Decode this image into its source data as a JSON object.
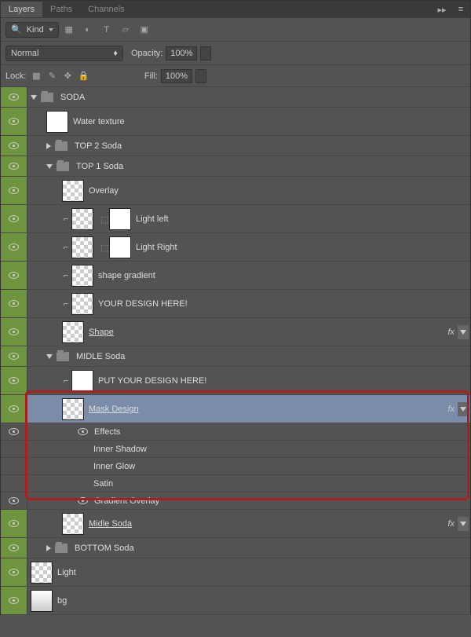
{
  "tabs": {
    "layers": "Layers",
    "paths": "Paths",
    "channels": "Channels"
  },
  "toolbar": {
    "kind_label": "Kind",
    "blend_mode": "Normal",
    "opacity_label": "Opacity:",
    "opacity_value": "100%",
    "lock_label": "Lock:",
    "fill_label": "Fill:",
    "fill_value": "100%"
  },
  "layers": [
    {
      "name": "SODA",
      "type": "group",
      "open": true,
      "indent": 0
    },
    {
      "name": "Water texture",
      "type": "layer",
      "thumb": "white",
      "indent": 1
    },
    {
      "name": "TOP 2 Soda",
      "type": "group",
      "open": false,
      "indent": 1
    },
    {
      "name": "TOP 1 Soda",
      "type": "group",
      "open": true,
      "indent": 1
    },
    {
      "name": "Overlay",
      "type": "layer",
      "thumb": "checker",
      "indent": 2
    },
    {
      "name": "Light left",
      "type": "layer",
      "thumb": "checker",
      "mask": true,
      "clip": true,
      "indent": 2
    },
    {
      "name": "Light Right",
      "type": "layer",
      "thumb": "checker",
      "mask": true,
      "clip": true,
      "indent": 2
    },
    {
      "name": "shape gradient",
      "type": "layer",
      "thumb": "checker",
      "clip": true,
      "indent": 2
    },
    {
      "name": "YOUR DESIGN HERE!",
      "type": "layer",
      "thumb": "checker",
      "clip": true,
      "indent": 2
    },
    {
      "name": "Shape ",
      "type": "layer",
      "thumb": "checker",
      "underline": true,
      "fx": true,
      "indent": 2
    },
    {
      "name": "MIDLE Soda",
      "type": "group",
      "open": true,
      "indent": 1
    },
    {
      "name": "PUT YOUR DESIGN HERE!",
      "type": "layer",
      "thumb": "white",
      "clip": true,
      "indent": 2
    },
    {
      "name": "Mask Design ",
      "type": "layer",
      "thumb": "checker",
      "underline": true,
      "fx": true,
      "selected": true,
      "indent": 2
    },
    {
      "name": "Effects",
      "type": "fx-header",
      "indent": 3
    },
    {
      "name": "Inner Shadow",
      "type": "fx-item",
      "indent": 4
    },
    {
      "name": "Inner Glow",
      "type": "fx-item",
      "indent": 4
    },
    {
      "name": "Satin",
      "type": "fx-item",
      "indent": 4
    },
    {
      "name": "Gradient Overlay",
      "type": "fx-item",
      "eye": true,
      "indent": 3
    },
    {
      "name": "Midle Soda",
      "type": "layer",
      "thumb": "checker",
      "underline": true,
      "fx": true,
      "indent": 2
    },
    {
      "name": "BOTTOM Soda",
      "type": "group",
      "open": false,
      "indent": 1
    },
    {
      "name": "Light",
      "type": "layer",
      "thumb": "checker",
      "indent": 0
    },
    {
      "name": "bg",
      "type": "layer",
      "thumb": "grad",
      "indent": 0
    }
  ]
}
